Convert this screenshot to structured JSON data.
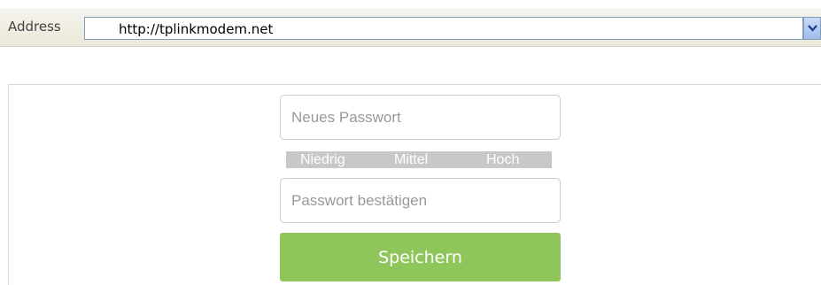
{
  "browser": {
    "address_label": "Address",
    "url": "http://tplinkmodem.net"
  },
  "form": {
    "new_password_placeholder": "Neues Passwort",
    "strength": {
      "low": "Niedrig",
      "medium": "Mittel",
      "high": "Hoch"
    },
    "confirm_password_placeholder": "Passwort bestätigen",
    "save_label": "Speichern"
  },
  "colors": {
    "save_button": "#8fc65b",
    "strength_bar": "#c8c8c8",
    "placeholder": "#999999"
  },
  "icons": {
    "address_dropdown": "chevron-down-icon"
  }
}
